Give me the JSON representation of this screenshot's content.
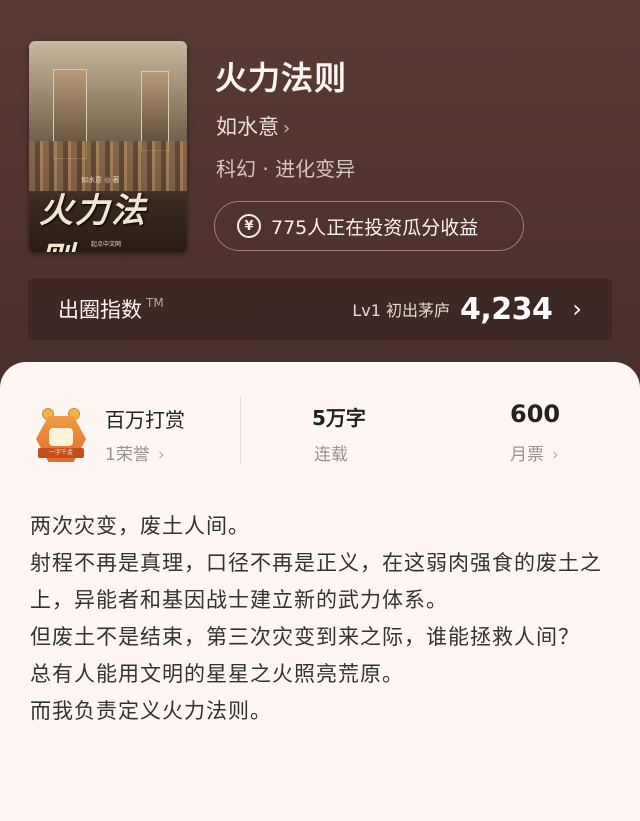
{
  "book": {
    "title": "火力法则",
    "author": "如水意",
    "author_chevron": "›",
    "genre": "科幻 · 进化变异",
    "cover": {
      "title": "火力法则",
      "author_small": "如水意 ◎ 著",
      "publisher_small": "起点中文网"
    }
  },
  "invest": {
    "icon": "yen-coin-icon",
    "icon_glyph": "¥",
    "text": "775人正在投资瓜分收益"
  },
  "index": {
    "label": "出圈指数",
    "tm": "TM",
    "level": "Lv1 初出茅庐",
    "value": "4,234",
    "chevron": "›"
  },
  "stats": {
    "reward": {
      "title": "百万打赏",
      "sub": "1荣誉",
      "chevron": "›",
      "badge_text": "一字千金"
    },
    "words": {
      "title": "5万字",
      "sub": "连载"
    },
    "tickets": {
      "title": "600",
      "sub": "月票",
      "chevron": "›"
    }
  },
  "description": [
    "两次灾变，废土人间。",
    "射程不再是真理，口径不再是正义，在这弱肉强食的废土之上，异能者和基因战士建立新的武力体系。",
    "但废土不是结束，第三次灾变到来之际，谁能拯救人间？",
    "总有人能用文明的星星之火照亮荒原。",
    "而我负责定义火力法则。"
  ],
  "colors": {
    "header_bg": "#4b302c",
    "sheet_bg": "#fdf6f3",
    "badge_orange": "#e46a2a"
  }
}
